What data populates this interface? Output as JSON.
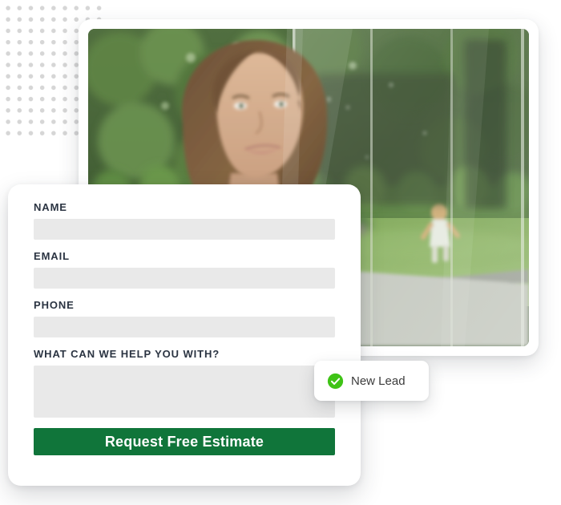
{
  "decor": {
    "dot_grid_name": "dot-grid-pattern",
    "dot_color": "#d6d6d6"
  },
  "photo_card": {
    "alt": "Smiling woman standing outdoors behind a glass patio door, with a child running on a green lawn in the background",
    "icon": "photo-image"
  },
  "form": {
    "fields": [
      {
        "label": "NAME",
        "value": "",
        "placeholder": "",
        "name": "name-field"
      },
      {
        "label": "EMAIL",
        "value": "",
        "placeholder": "",
        "name": "email-field"
      },
      {
        "label": "PHONE",
        "value": "",
        "placeholder": "",
        "name": "phone-field"
      }
    ],
    "message": {
      "label": "WHAT CAN WE HELP YOU WITH?",
      "value": "",
      "placeholder": ""
    },
    "submit_label": "Request Free Estimate",
    "submit_color": "#10753a"
  },
  "toast": {
    "label": "New Lead",
    "icon": "check-circle-icon",
    "icon_color": "#3fc316"
  }
}
